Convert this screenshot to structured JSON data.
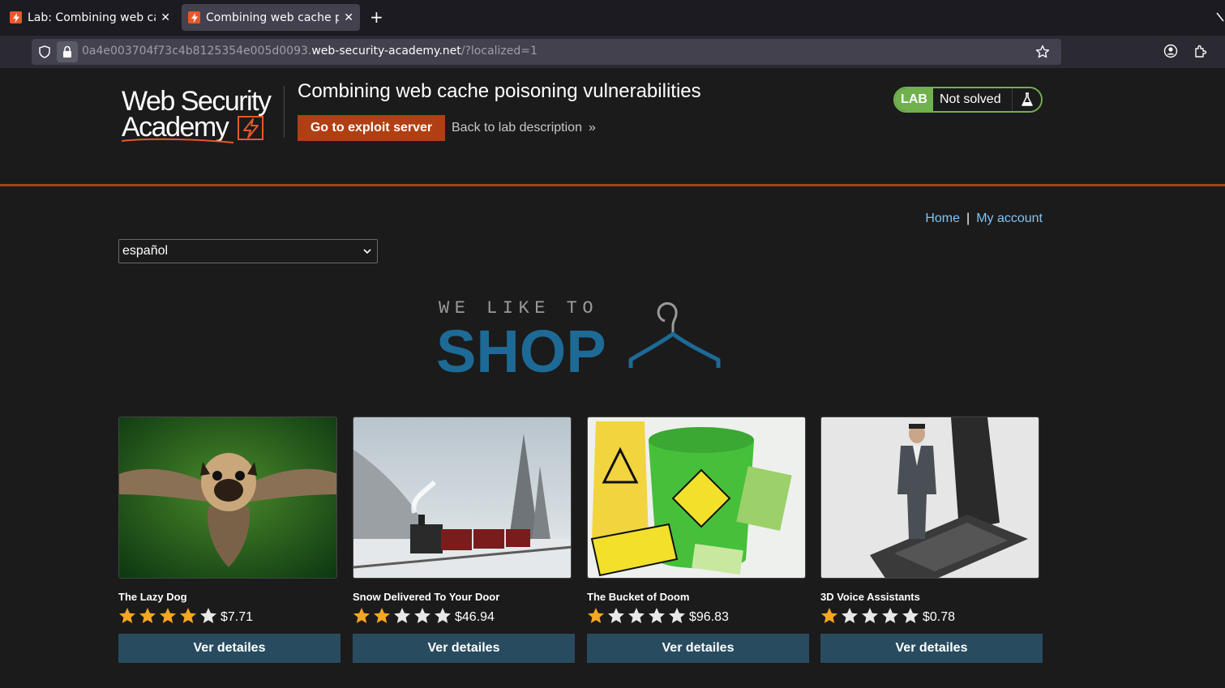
{
  "browser": {
    "tabs": [
      {
        "title": "Lab: Combining web cach",
        "active": false
      },
      {
        "title": "Combining web cache po",
        "active": true
      }
    ],
    "url": {
      "prefix": "0a4e003704f73c4b8125354e005d0093.",
      "domain": "web-security-academy.net",
      "path": "/?localized=1"
    }
  },
  "lab": {
    "logo_text_line1": "Web Security",
    "logo_text_line2": "Academy",
    "title": "Combining web cache poisoning vulnerabilities",
    "exploit_button": "Go to exploit server",
    "back_link": "Back to lab description",
    "status_badge": "LAB",
    "status_text": "Not solved",
    "accent_color": "#b03f13",
    "status_color": "#70b04f"
  },
  "shop": {
    "nav": {
      "home": "Home",
      "separator": "|",
      "account": "My account"
    },
    "language": "español",
    "logo": {
      "tagline": "WE LIKE TO",
      "word": "SHOP"
    },
    "products": [
      {
        "name": "The Lazy Dog",
        "rating": 4,
        "price": "$7.71",
        "button": "Ver detailes"
      },
      {
        "name": "Snow Delivered To Your Door",
        "rating": 2,
        "price": "$46.94",
        "button": "Ver detailes"
      },
      {
        "name": "The Bucket of Doom",
        "rating": 1,
        "price": "$96.83",
        "button": "Ver detailes"
      },
      {
        "name": "3D Voice Assistants",
        "rating": 1,
        "price": "$0.78",
        "button": "Ver detailes"
      }
    ]
  }
}
